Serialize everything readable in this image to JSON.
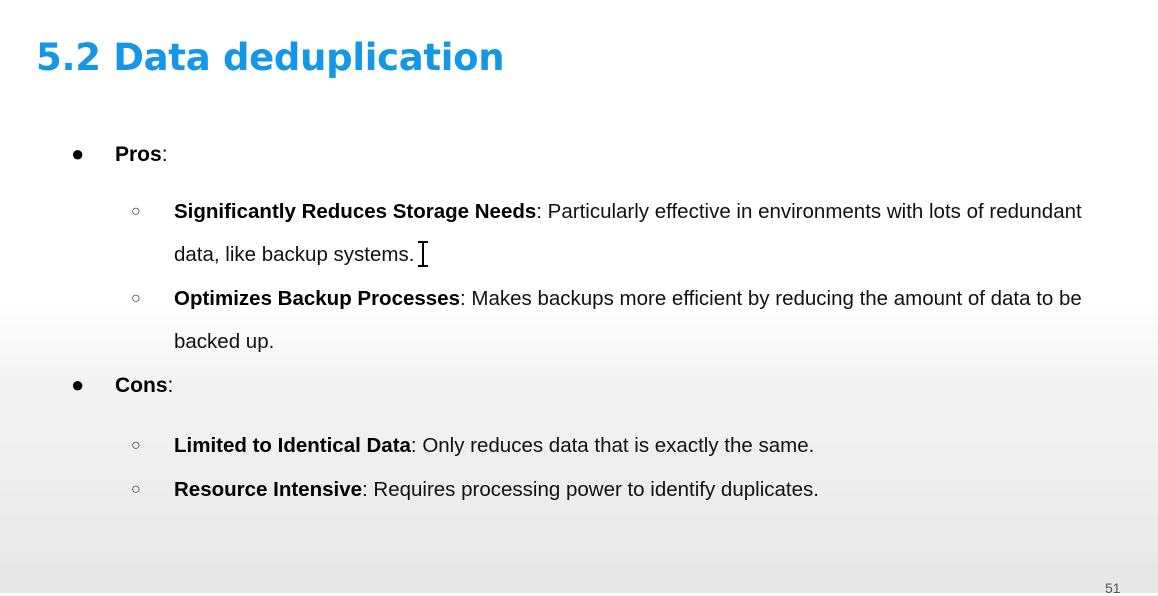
{
  "slide": {
    "title": "5.2 Data deduplication",
    "page_number": "51"
  },
  "pros": {
    "label": "Pros",
    "colon": ":",
    "items": [
      {
        "term": "Significantly Reduces Storage Needs",
        "description": ": Particularly effective in environments with lots of redundant data, like backup systems."
      },
      {
        "term": "Optimizes Backup Processes",
        "description": ": Makes backups more efficient by reducing the amount of data to be backed up."
      }
    ]
  },
  "cons": {
    "label": "Cons",
    "colon": ":",
    "items": [
      {
        "term": "Limited to Identical Data",
        "description": ": Only reduces data that is exactly the same."
      },
      {
        "term": "Resource Intensive",
        "description": ": Requires processing power to identify duplicates."
      }
    ]
  },
  "icons": {
    "cursor": "text-cursor-icon"
  }
}
